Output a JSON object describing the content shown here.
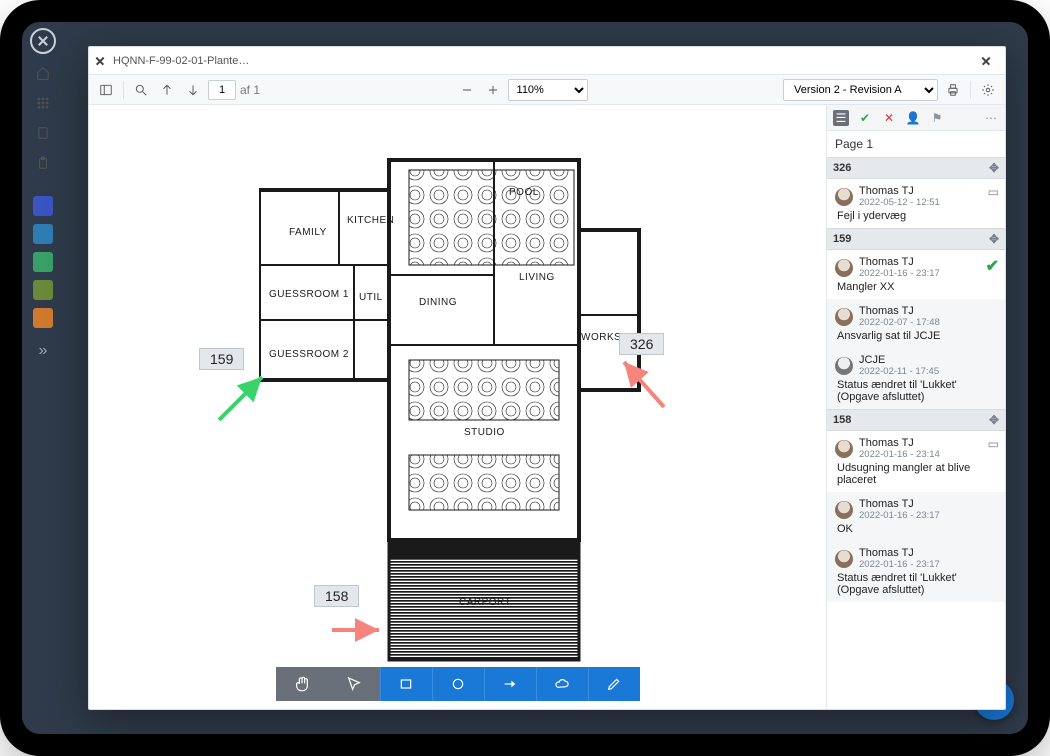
{
  "tab": {
    "title": "HQNN-F-99-02-01-Plante…"
  },
  "toolbar": {
    "page_current": "1",
    "page_of_label": "af 1",
    "zoom": "110%",
    "version": "Version 2 - Revision A"
  },
  "plan": {
    "rooms": {
      "family": "FAMILY",
      "kitchen": "KITCHEN",
      "guessroom1": "GUESSROOM 1",
      "guessroom2": "GUESSROOM 2",
      "util": "UTIL",
      "dining": "DINING",
      "pool": "POOL",
      "living": "LIVING",
      "workshop": "WORKSHOP",
      "studio": "STUDIO",
      "carport": "CARPORT"
    }
  },
  "pins": {
    "p159": "159",
    "p326": "326",
    "p158": "158"
  },
  "side": {
    "page_label": "Page 1",
    "items": [
      {
        "id": "326",
        "entries": [
          {
            "user": "Thomas TJ",
            "date": "2022-05-12 - 12:51",
            "text": "Fejl i ydervæg",
            "date_icon": true
          }
        ]
      },
      {
        "id": "159",
        "entries": [
          {
            "user": "Thomas TJ",
            "date": "2022-01-16 - 23:17",
            "text": "Mangler XX",
            "check": true
          },
          {
            "user": "Thomas TJ",
            "date": "2022-02-07 - 17:48",
            "text": "Ansvarlig sat til JCJE",
            "sub": true
          },
          {
            "user": "JCJE",
            "date": "2022-02-11 - 17:45",
            "text": "Status ændret til 'Lukket' (Opgave afsluttet)",
            "sub": true,
            "gavatar": true
          }
        ]
      },
      {
        "id": "158",
        "entries": [
          {
            "user": "Thomas TJ",
            "date": "2022-01-16 - 23:14",
            "text": "Udsugning mangler at blive placeret",
            "date_icon": true
          },
          {
            "user": "Thomas TJ",
            "date": "2022-01-16 - 23:17",
            "text": "OK",
            "sub": true
          },
          {
            "user": "Thomas TJ",
            "date": "2022-01-16 - 23:17",
            "text": "Status ændret til 'Lukket' (Opgave afsluttet)",
            "sub": true
          }
        ]
      }
    ]
  }
}
